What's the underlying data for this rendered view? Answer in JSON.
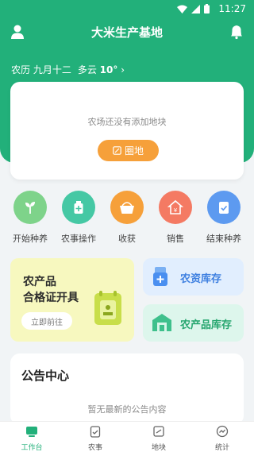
{
  "status": {
    "time": "11:27"
  },
  "header": {
    "title": "大米生产基地"
  },
  "weather": {
    "lunar": "农历 九月十二",
    "condition": "多云",
    "temp": "10°",
    "arrow": "›"
  },
  "farm": {
    "empty_text": "农场还没有添加地块",
    "button_label": "圈地"
  },
  "quick_actions": [
    {
      "label": "开始种养",
      "color": "#7ed38a"
    },
    {
      "label": "农事操作",
      "color": "#45c8a4"
    },
    {
      "label": "收获",
      "color": "#f6a03a"
    },
    {
      "label": "销售",
      "color": "#f47a63"
    },
    {
      "label": "结束种养",
      "color": "#5d9af0"
    }
  ],
  "certificate": {
    "line1": "农产品",
    "line2": "合格证开具",
    "button": "立即前往"
  },
  "inventory": {
    "supplies": "农资库存",
    "products": "农产品库存"
  },
  "notice": {
    "title": "公告中心",
    "empty_text": "暂无最新的公告内容"
  },
  "tabs": [
    {
      "label": "工作台"
    },
    {
      "label": "农事"
    },
    {
      "label": "地块"
    },
    {
      "label": "统计"
    }
  ],
  "colors": {
    "brand": "#22b07a",
    "accent": "#f6a03a"
  }
}
